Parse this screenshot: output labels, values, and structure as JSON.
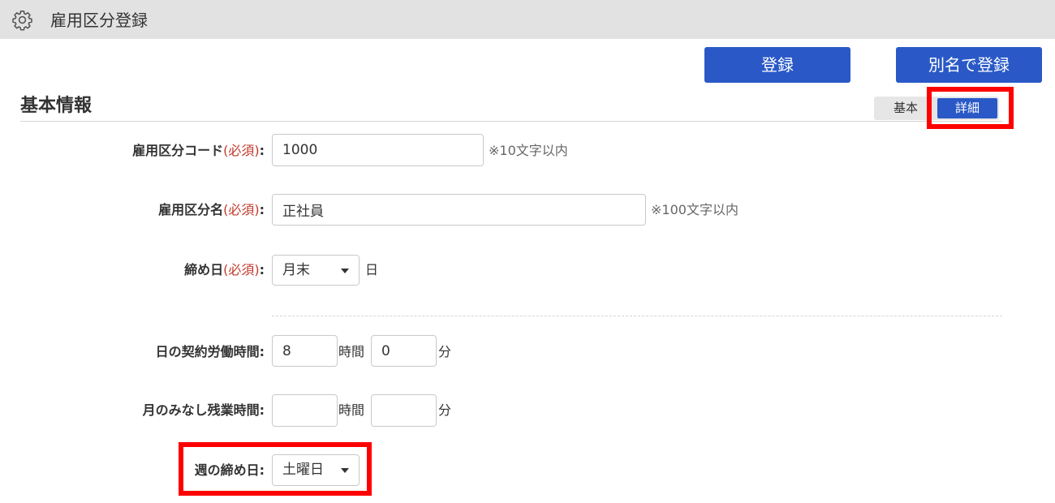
{
  "header": {
    "title": "雇用区分登録",
    "icon": "gear-icon"
  },
  "actions": {
    "register_label": "登録",
    "register_alias_label": "別名で登録"
  },
  "section": {
    "title": "基本情報"
  },
  "view_toggle": {
    "basic_label": "基本",
    "detail_label": "詳細",
    "selected": "詳細"
  },
  "form": {
    "code": {
      "label": "雇用区分コード",
      "required": "(必須)",
      "colon": ":",
      "value": "1000",
      "note": "※10文字以内"
    },
    "name": {
      "label": "雇用区分名",
      "required": "(必須)",
      "colon": ":",
      "value": "正社員",
      "note": "※100文字以内"
    },
    "closing_day": {
      "label": "締め日",
      "required": "(必須)",
      "colon": ":",
      "value": "月末",
      "unit": "日"
    },
    "daily_hours": {
      "label": "日の契約労働時間",
      "colon": ":",
      "hours_value": "8",
      "hours_unit": "時間",
      "minutes_value": "0",
      "minutes_unit": "分"
    },
    "overtime": {
      "label": "月のみなし残業時間",
      "colon": ":",
      "hours_value": "",
      "hours_unit": "時間",
      "minutes_value": "",
      "minutes_unit": "分"
    },
    "week_closing": {
      "label": "週の締め日",
      "colon": ":",
      "value": "土曜日"
    }
  },
  "colors": {
    "accent": "#2a59c7",
    "highlight": "#ff0000",
    "required": "#c0392b",
    "header_bg": "#e2e2e2"
  }
}
